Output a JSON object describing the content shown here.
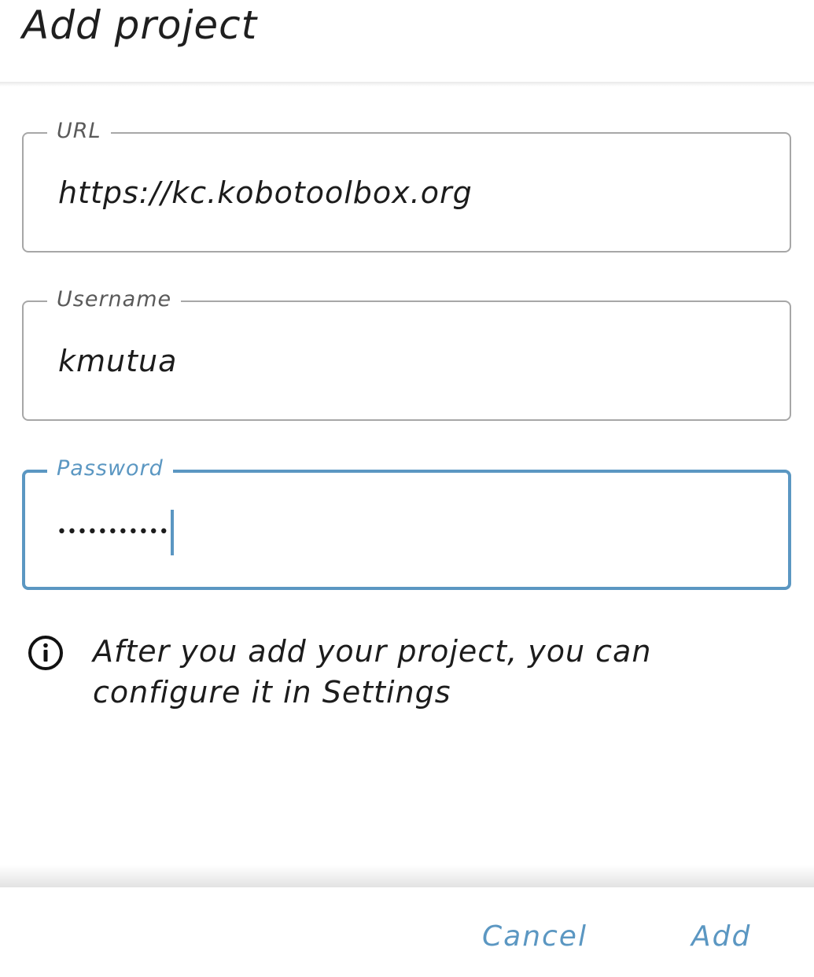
{
  "dialog": {
    "title": "Add project"
  },
  "fields": {
    "url": {
      "label": "URL",
      "value": "https://kc.kobotoolbox.org"
    },
    "username": {
      "label": "Username",
      "value": "kmutua"
    },
    "password": {
      "label": "Password",
      "masked_value": "•••••••••••"
    }
  },
  "info": {
    "icon": "info-icon",
    "text": "After you add your project, you can configure it in Settings"
  },
  "actions": {
    "cancel_label": "Cancel",
    "add_label": "Add"
  },
  "colors": {
    "accent": "#5b97c2",
    "border": "#a7a7a7",
    "text": "#1c1c1c"
  }
}
